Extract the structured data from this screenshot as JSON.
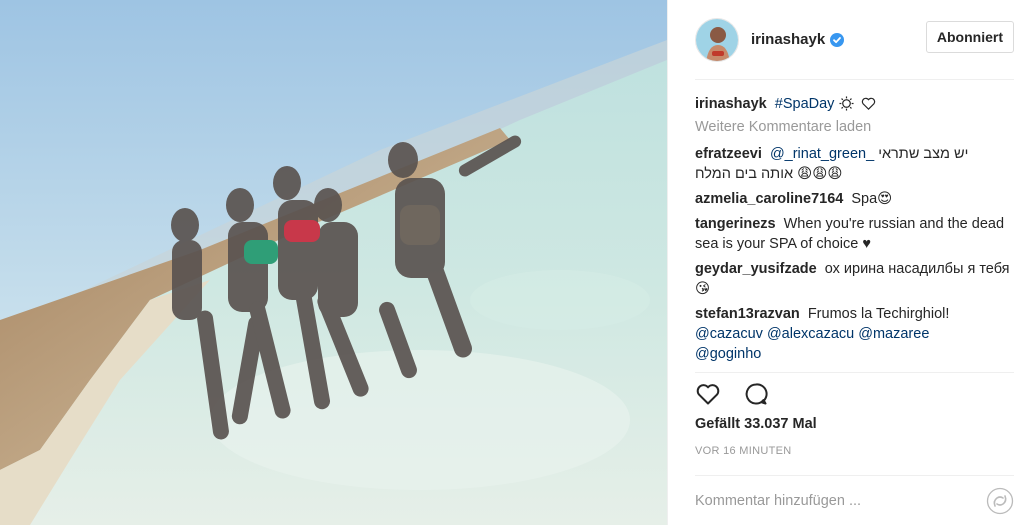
{
  "post": {
    "author": "irinashayk",
    "follow_label": "Abonniert",
    "caption_user": "irinashayk",
    "caption_tag": "#SpaDay",
    "load_more": "Weitere Kommentare laden",
    "comments": [
      {
        "user": "efratzeevi",
        "mention": "@_rinat_green_",
        "text_rtl_1": "יש מצב שתראי",
        "text_rtl_2": "אותה בים המלח"
      },
      {
        "user": "azmelia_caroline7164",
        "text": "Spa"
      },
      {
        "user": "tangerinezs",
        "text": "When you're russian and the dead sea is your SPA of choice"
      },
      {
        "user": "geydar_yusifzade",
        "text": "ох ирина насадилбы я тебя"
      },
      {
        "user": "stefan13razvan",
        "text": "Frumos la Techirghiol!",
        "mentions": [
          "@cazacuv",
          "@alexcazacu",
          "@mazaree",
          "@goginho"
        ]
      }
    ],
    "likes": "Gefällt 33.037 Mal",
    "timestamp": "VOR 16 MINUTEN",
    "comment_placeholder": "Kommentar hinzufügen ..."
  },
  "icons": {
    "verified": "verified-badge-icon",
    "heart": "heart-icon",
    "comment": "comment-icon",
    "options": "more-options-icon"
  },
  "colors": {
    "link": "#003569",
    "verified": "#3897f0",
    "muted": "#999999"
  }
}
